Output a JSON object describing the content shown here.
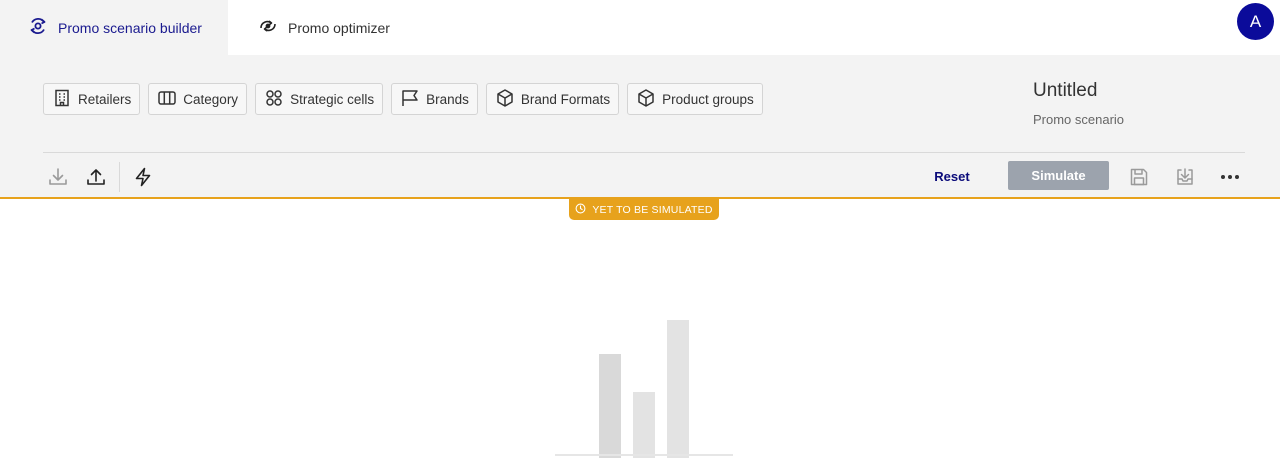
{
  "tabs": [
    {
      "label": "Promo scenario builder",
      "icon": "scenario-builder-icon",
      "active": true
    },
    {
      "label": "Promo optimizer",
      "icon": "optimizer-icon",
      "active": false
    }
  ],
  "user": {
    "avatar_initial": "A"
  },
  "filters": [
    {
      "label": "Retailers",
      "icon": "building-icon"
    },
    {
      "label": "Category",
      "icon": "columns-icon"
    },
    {
      "label": "Strategic cells",
      "icon": "grid-circles-icon"
    },
    {
      "label": "Brands",
      "icon": "flag-icon"
    },
    {
      "label": "Brand Formats",
      "icon": "cube-icon"
    },
    {
      "label": "Product groups",
      "icon": "cube-icon"
    }
  ],
  "scenario": {
    "title": "Untitled",
    "subtitle": "Promo scenario"
  },
  "toolbar": {
    "left_icons": [
      "download-icon",
      "upload-icon",
      "lightning-icon"
    ],
    "reset_label": "Reset",
    "simulate_label": "Simulate",
    "right_icons": [
      "save-icon",
      "download-tray-icon",
      "more-icon"
    ]
  },
  "status": {
    "label": "YET TO BE SIMULATED",
    "icon": "clock-icon",
    "color": "#e7a21c"
  },
  "colors": {
    "accent": "#0b0b9a",
    "status": "#e7a21c",
    "simulate_disabled": "#9ca3ad"
  }
}
